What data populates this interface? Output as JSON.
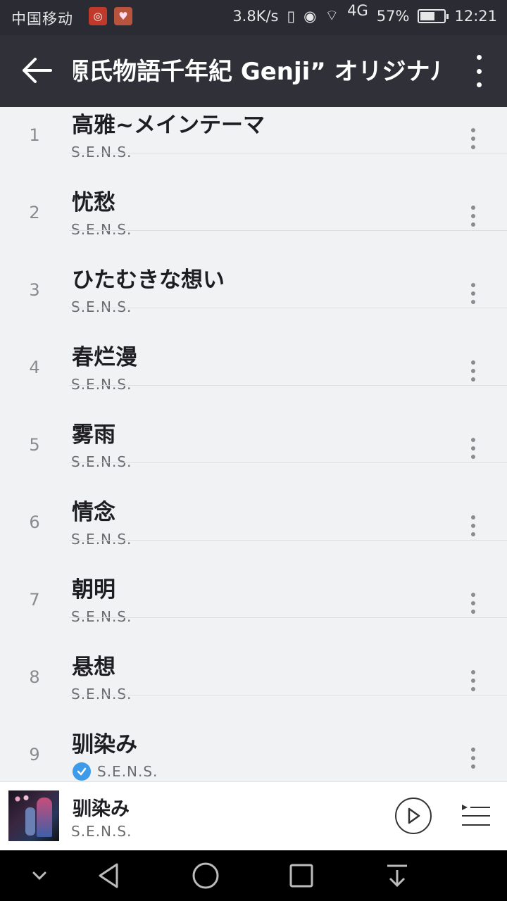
{
  "status_bar": {
    "carrier": "中国移动",
    "speed": "3.8K/s",
    "network": "4G",
    "battery": "57%",
    "time": "12:21"
  },
  "app_bar": {
    "title": "源氏物語千年紀 Genji” オリジナル・サウンドトラック"
  },
  "tracks": [
    {
      "num": "1",
      "title": "高雅~メインテーマ",
      "artist": "S.E.N.S.",
      "downloaded": false
    },
    {
      "num": "2",
      "title": "忧愁",
      "artist": "S.E.N.S.",
      "downloaded": false
    },
    {
      "num": "3",
      "title": "ひたむきな想い",
      "artist": "S.E.N.S.",
      "downloaded": false
    },
    {
      "num": "4",
      "title": "春烂漫",
      "artist": "S.E.N.S.",
      "downloaded": false
    },
    {
      "num": "5",
      "title": "雾雨",
      "artist": "S.E.N.S.",
      "downloaded": false
    },
    {
      "num": "6",
      "title": "情念",
      "artist": "S.E.N.S.",
      "downloaded": false
    },
    {
      "num": "7",
      "title": "朝明",
      "artist": "S.E.N.S.",
      "downloaded": false
    },
    {
      "num": "8",
      "title": "悬想",
      "artist": "S.E.N.S.",
      "downloaded": false
    },
    {
      "num": "9",
      "title": "驯染み",
      "artist": "S.E.N.S.",
      "downloaded": true
    }
  ],
  "now_playing": {
    "title": "驯染み",
    "artist": "S.E.N.S."
  },
  "colors": {
    "app_bar": "#2f3038",
    "status_bar": "#2b2c33",
    "list_background": "#f1f2f4",
    "downloaded_check": "#3d9be9"
  }
}
